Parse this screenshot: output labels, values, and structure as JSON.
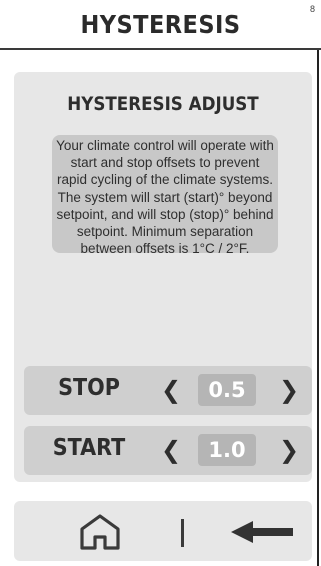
{
  "header": {
    "title": "HYSTERESIS",
    "corner_mark": "8"
  },
  "panel": {
    "title": "HYSTERESIS ADJUST",
    "description": "Your climate control will operate with start and stop offsets to prevent rapid cycling of the climate systems. The system will start (start)° beyond setpoint, and will stop (stop)° behind setpoint. Minimum separation between offsets is 1°C / 2°F."
  },
  "controls": {
    "stop": {
      "label": "STOP",
      "value": "0.5",
      "decrease_icon": "chevron-left-icon",
      "increase_icon": "chevron-right-icon"
    },
    "start": {
      "label": "START",
      "value": "1.0",
      "decrease_icon": "chevron-left-icon",
      "increase_icon": "chevron-right-icon"
    }
  },
  "nav": {
    "home_icon": "home-icon",
    "back_icon": "back-arrow-icon"
  },
  "colors": {
    "panel_bg": "#e7e7e7",
    "description_bg": "#c8c8c8",
    "control_bg": "#cfcfcf",
    "value_bg": "#b5b5b5",
    "value_text": "#ffffff",
    "text": "#2e2e2e"
  }
}
